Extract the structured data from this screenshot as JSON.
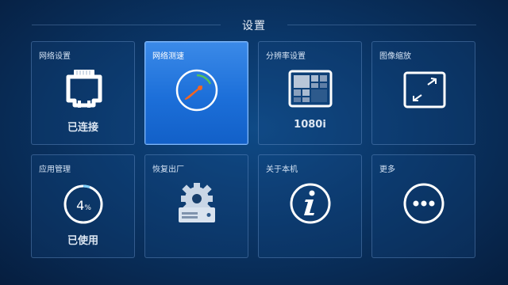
{
  "header": {
    "title": "设置"
  },
  "tiles": [
    {
      "label": "网络设置",
      "status": "已连接",
      "icon": "ethernet-icon"
    },
    {
      "label": "网络测速",
      "icon": "speedometer-icon",
      "selected": true
    },
    {
      "label": "分辨率设置",
      "status": "1080i",
      "icon": "resolution-grid-icon"
    },
    {
      "label": "图像缩放",
      "icon": "expand-arrows-icon"
    },
    {
      "label": "应用管理",
      "status": "已使用",
      "icon": "storage-usage-ring-icon",
      "usage_value": "4",
      "usage_unit": "%",
      "usage_fraction": 0.04
    },
    {
      "label": "恢复出厂",
      "icon": "gear-server-icon"
    },
    {
      "label": "关于本机",
      "icon": "info-icon"
    },
    {
      "label": "更多",
      "icon": "more-dots-icon"
    }
  ],
  "colors": {
    "background": "#0a3566",
    "selected_tile": "#1c6fd9",
    "gauge_orange": "#f26522",
    "gauge_green": "#54c25a"
  }
}
